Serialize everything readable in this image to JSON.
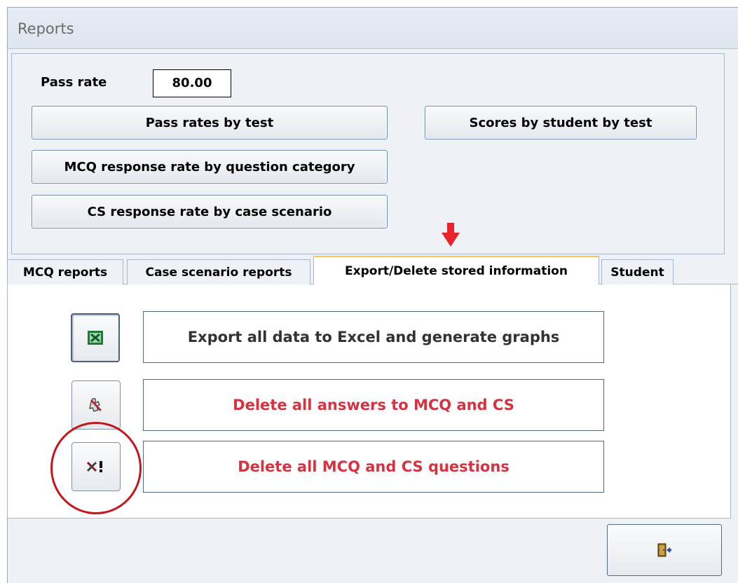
{
  "window": {
    "title": "Reports"
  },
  "pass_rate": {
    "label": "Pass rate",
    "value": "80.00"
  },
  "report_buttons": {
    "pass_rates_by_test": "Pass rates by test",
    "scores_by_student_by_test": "Scores by student by test",
    "mcq_response_rate": "MCQ response rate by question category",
    "cs_response_rate": "CS response rate by case scenario"
  },
  "tabs": [
    {
      "label": "MCQ reports",
      "active": false
    },
    {
      "label": "Case scenario reports",
      "active": false
    },
    {
      "label": "Export/Delete stored information",
      "active": true
    },
    {
      "label": "Student",
      "active": false
    }
  ],
  "actions": {
    "export": {
      "label": "Export all data to Excel and generate graphs",
      "icon": "excel-icon"
    },
    "delete_answers": {
      "label": "Delete all answers to MCQ and CS",
      "icon": "delete-answers-icon"
    },
    "delete_questions": {
      "label": "Delete all MCQ and CS questions",
      "icon": "delete-questions-icon"
    }
  },
  "footer": {
    "exit_icon": "exit-door-icon"
  },
  "annotations": {
    "arrow_color": "#e8232a",
    "circle_color": "#c4161c"
  },
  "colors": {
    "danger_text": "#d6323f",
    "excel_green": "#1f7a3a",
    "tab_highlight": "#f3c55c"
  }
}
